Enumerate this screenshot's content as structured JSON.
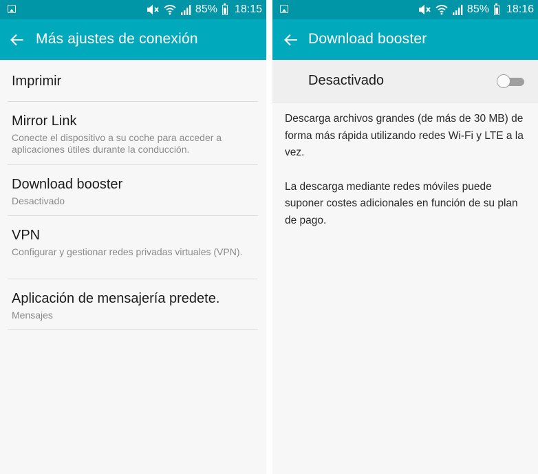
{
  "colors": {
    "status_bar": "#0096a8",
    "app_bar": "#00a9bc",
    "background": "#f7f7f7",
    "divider": "#dcdcdc",
    "toggle_off": "#9f9f9f"
  },
  "status_icons": [
    "gallery-icon",
    "mute-icon",
    "wifi-icon",
    "signal-icon",
    "battery-icon"
  ],
  "left_screen": {
    "status": {
      "battery_percent": "85%",
      "time": "18:15"
    },
    "appbar": {
      "title": "Más ajustes de conexión"
    },
    "items": [
      {
        "title": "Imprimir"
      },
      {
        "title": "Mirror Link",
        "subtitle": "Conecte el dispositivo a su coche para acceder a aplicaciones útiles durante la conducción."
      },
      {
        "title": "Download booster",
        "subtitle": "Desactivado"
      },
      {
        "title": "VPN",
        "subtitle": "Configurar y gestionar redes privadas virtuales (VPN)."
      },
      {
        "title": "Aplicación de mensajería predete.",
        "subtitle": "Mensajes"
      }
    ]
  },
  "right_screen": {
    "status": {
      "battery_percent": "85%",
      "time": "18:16"
    },
    "appbar": {
      "title": "Download booster"
    },
    "toggle": {
      "label": "Desactivado",
      "on": false
    },
    "description": [
      "Descarga archivos grandes (de más de 30 MB) de forma más rápida utilizando redes Wi-Fi y LTE a la vez.",
      "La descarga mediante redes móviles puede suponer costes adicionales en función de su plan de pago."
    ]
  }
}
